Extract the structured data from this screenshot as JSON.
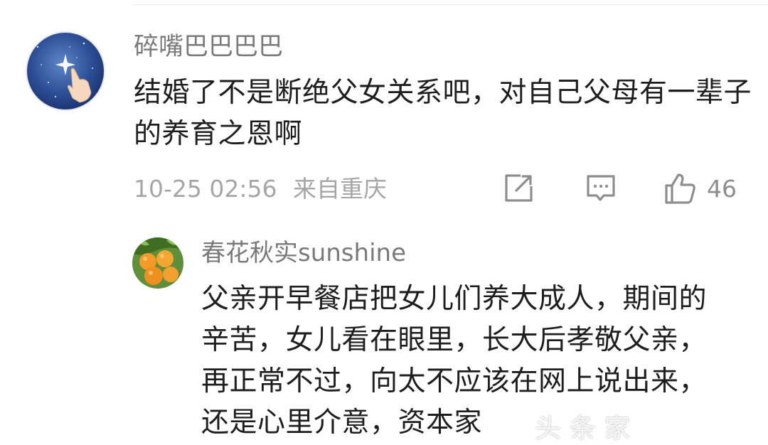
{
  "comment": {
    "username": "碎嘴巴巴巴巴",
    "text": "结婚了不是断绝父女关系吧，对自己父母有一辈子的养育之恩啊",
    "date": "10-25 02:56",
    "location": "来自重庆",
    "share_icon": "share-icon",
    "reply_icon": "comment-icon",
    "like_icon": "thumbs-up-icon",
    "like_count": "46"
  },
  "reply": {
    "username": "春花秋实sunshine",
    "text": "父亲开早餐店把女儿们养大成人，期间的辛苦，女儿看在眼里，长大后孝敬父亲，再正常不过，向太不应该在网上说出来，还是心里介意，资本家"
  },
  "watermark": {
    "text": "头 条 家"
  },
  "colors": {
    "username": "#7a7a7a",
    "body_text": "#1e1e1e",
    "meta_text": "#a6a6a6",
    "icon": "#8e8e8e"
  }
}
